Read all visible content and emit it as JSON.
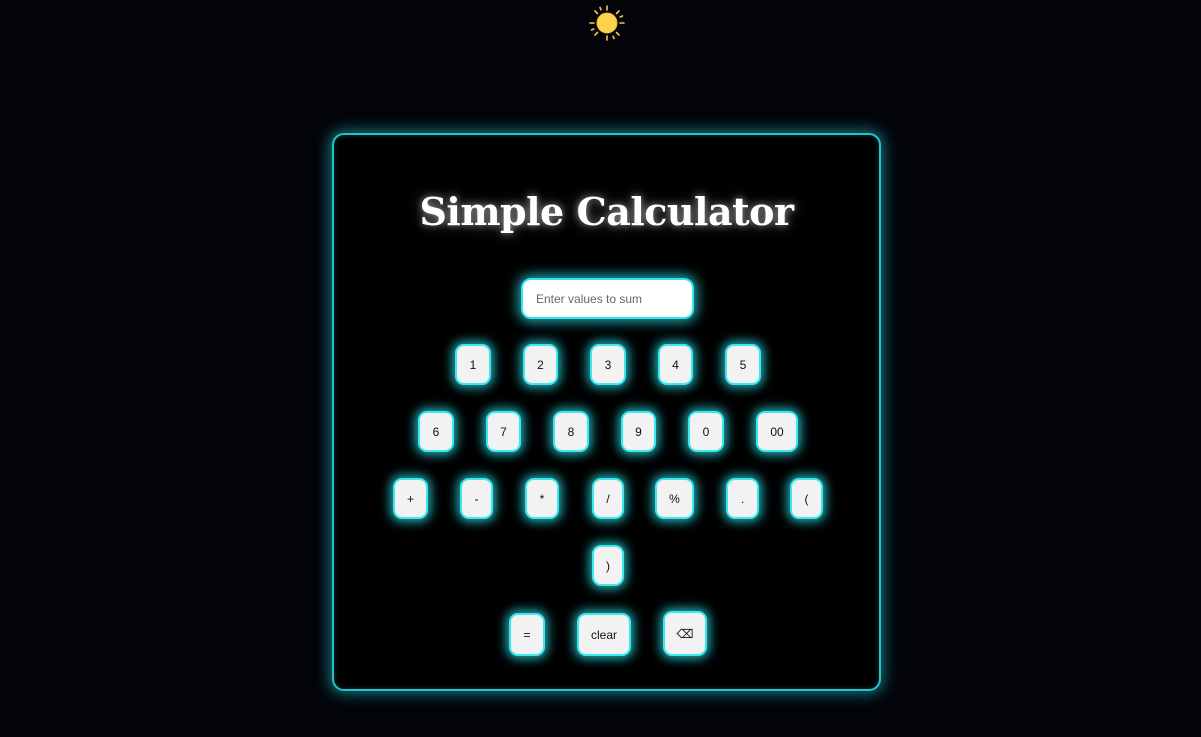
{
  "theme_toggle": {
    "icon": "sun-icon",
    "color": "#f7c948"
  },
  "calculator": {
    "title": "Simple Calculator",
    "display": {
      "value": "",
      "placeholder": "Enter values to sum"
    },
    "keys": {
      "k1": "1",
      "k2": "2",
      "k3": "3",
      "k4": "4",
      "k5": "5",
      "k6": "6",
      "k7": "7",
      "k8": "8",
      "k9": "9",
      "k0": "0",
      "k00": "00",
      "plus": "+",
      "minus": "-",
      "multiply": "*",
      "divide": "/",
      "percent": "%",
      "dot": ".",
      "open_paren": "(",
      "close_paren": ")",
      "equals": "=",
      "clear": "clear",
      "backspace": "⌫"
    }
  },
  "colors": {
    "background": "#02040a",
    "accent_glow": "#2ee6ee",
    "card_border": "#22c2cc",
    "key_background": "#f2f2f2"
  }
}
